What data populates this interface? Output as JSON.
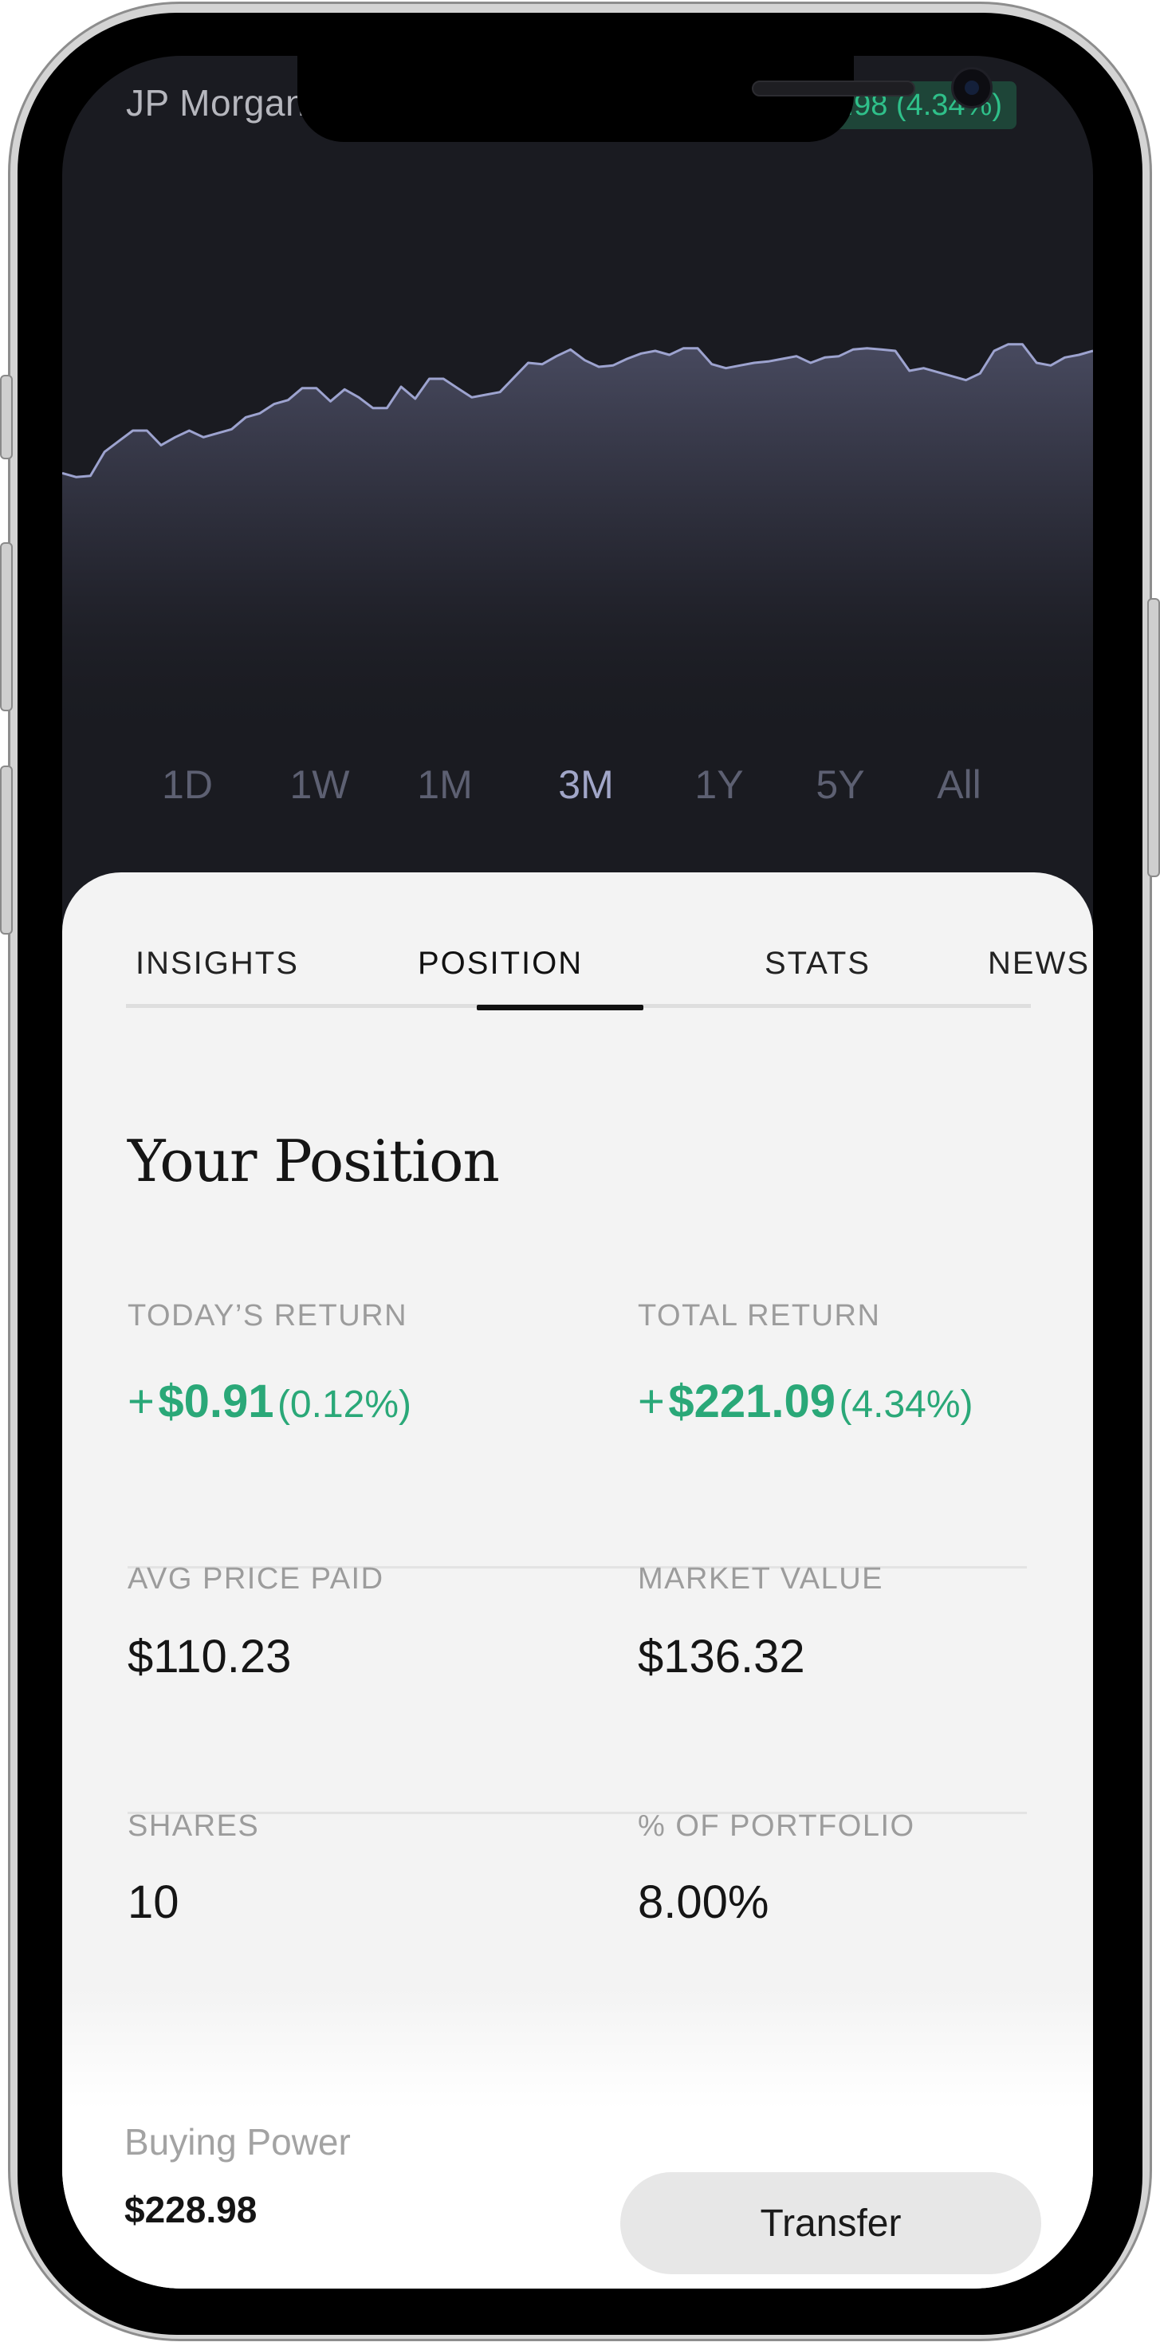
{
  "header": {
    "stock_name": "JP Morgan",
    "change_text": ".98 (4.34%)"
  },
  "chart_data": {
    "type": "area",
    "title": "",
    "xlabel": "",
    "ylabel": "",
    "grid": false,
    "x": [
      0,
      1,
      2,
      3,
      4,
      5,
      6,
      7,
      8,
      9,
      10,
      11,
      12,
      13,
      14,
      15,
      16,
      17,
      18,
      19,
      20,
      21,
      22,
      23,
      24,
      25,
      26,
      27,
      28,
      29,
      30,
      31,
      32,
      33,
      34,
      35,
      36,
      37,
      38,
      39,
      40,
      41,
      42,
      43,
      44,
      45,
      46,
      47,
      48,
      49,
      50,
      51,
      52,
      53,
      54,
      55,
      56,
      57,
      58,
      59,
      60,
      61,
      62,
      63,
      64,
      65,
      66,
      67,
      68,
      69,
      70,
      71,
      72,
      73
    ],
    "values": [
      100.0,
      98.5,
      99.0,
      108.0,
      112.0,
      116.0,
      116.0,
      110.5,
      113.5,
      116.0,
      113.5,
      115.0,
      116.5,
      121.0,
      122.5,
      126.0,
      127.5,
      132.0,
      132.0,
      127.0,
      131.5,
      128.5,
      124.5,
      124.5,
      132.5,
      128.0,
      135.5,
      135.5,
      132.0,
      128.5,
      129.5,
      130.5,
      136.0,
      141.5,
      141.0,
      144.0,
      146.5,
      142.5,
      140.0,
      140.5,
      143.0,
      145.0,
      146.0,
      144.5,
      147.0,
      147.0,
      141.0,
      139.5,
      140.5,
      141.5,
      142.0,
      143.0,
      144.0,
      141.5,
      143.5,
      144.0,
      146.5,
      147.0,
      146.5,
      146.0,
      138.5,
      139.5,
      138.0,
      136.5,
      135.0,
      137.5,
      146.0,
      148.5,
      148.5,
      141.5,
      140.5,
      143.5,
      144.5,
      146.0
    ],
    "ylim": [
      95,
      155
    ]
  },
  "ranges": [
    "1D",
    "1W",
    "1M",
    "3M",
    "1Y",
    "5Y",
    "All"
  ],
  "active_range": "3M",
  "tabs": [
    "INSIGHTS",
    "POSITION",
    "STATS",
    "NEWS"
  ],
  "active_tab": "POSITION",
  "position": {
    "title": "Your Position",
    "todays_return": {
      "label": "TODAY’S RETURN",
      "sign": "+",
      "amount": "$0.91",
      "percent": "(0.12%)"
    },
    "total_return": {
      "label": "TOTAL RETURN",
      "sign": "+",
      "amount": "$221.09",
      "percent": "(4.34%)"
    },
    "avg_price_paid": {
      "label": "AVG PRICE PAID",
      "value": "$110.23"
    },
    "market_value": {
      "label": "MARKET VALUE",
      "value": "$136.32"
    },
    "shares": {
      "label": "SHARES",
      "value": "10"
    },
    "pct_portfolio": {
      "label": "% OF PORTFOLIO",
      "value": "8.00%"
    }
  },
  "footer": {
    "buying_power_label": "Buying Power",
    "buying_power_value": "$228.98",
    "transfer_label": "Transfer"
  },
  "colors": {
    "positive": "#2aa878",
    "chart_line": "#9da3cf",
    "screen_bg": "#1a1b21",
    "card_bg": "#f3f3f3"
  }
}
